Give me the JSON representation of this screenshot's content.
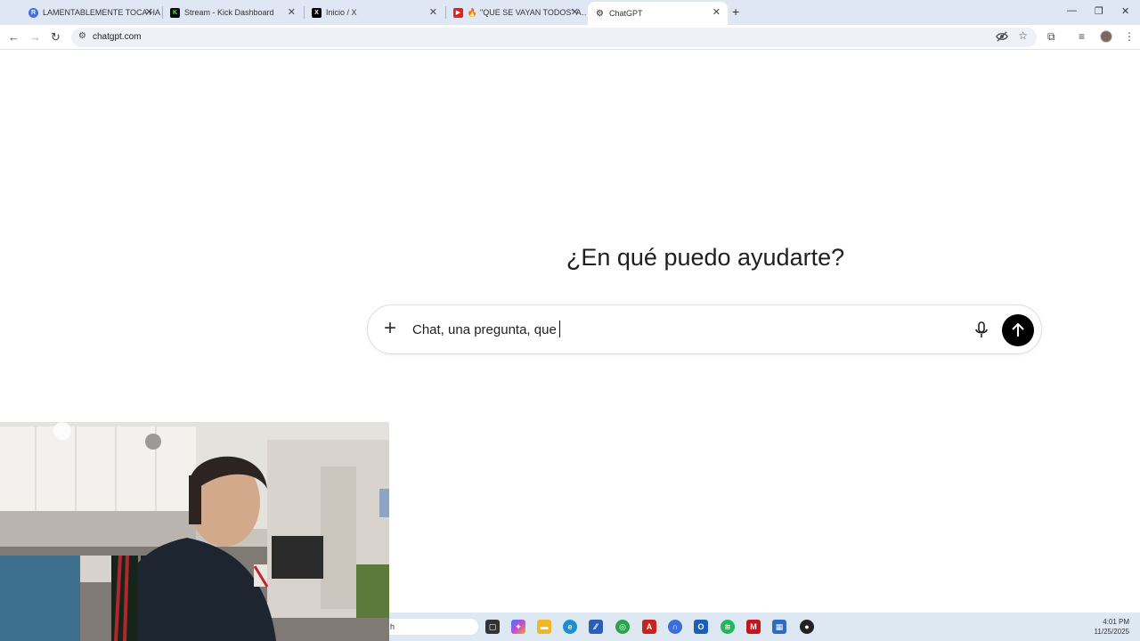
{
  "browser": {
    "tabs": [
      {
        "label": "LAMENTABLEMENTE TOCA HA…",
        "icon": "r-avatar-icon",
        "active": false
      },
      {
        "label": "Stream - Kick Dashboard",
        "icon": "kick-logo-icon",
        "active": false
      },
      {
        "label": "Inicio / X",
        "icon": "x-logo-icon",
        "active": false
      },
      {
        "label": "\"QUE SE VAYAN TODOS\" A…",
        "icon": "youtube-icon",
        "active": false
      },
      {
        "label": "ChatGPT",
        "icon": "chatgpt-logo-icon",
        "active": true
      }
    ],
    "url": "chatgpt.com"
  },
  "page": {
    "heading": "¿En qué puedo ayudarte?",
    "composer": {
      "input_value": "Chat, una pregunta, que"
    }
  },
  "taskbar": {
    "search_text": "h",
    "time": "4:01 PM",
    "date": "11/25/2025"
  },
  "colors": {
    "tabstrip_bg": "#dfe7f5",
    "send_button": "#000000",
    "taskbar_bg": "#dee8f2"
  }
}
